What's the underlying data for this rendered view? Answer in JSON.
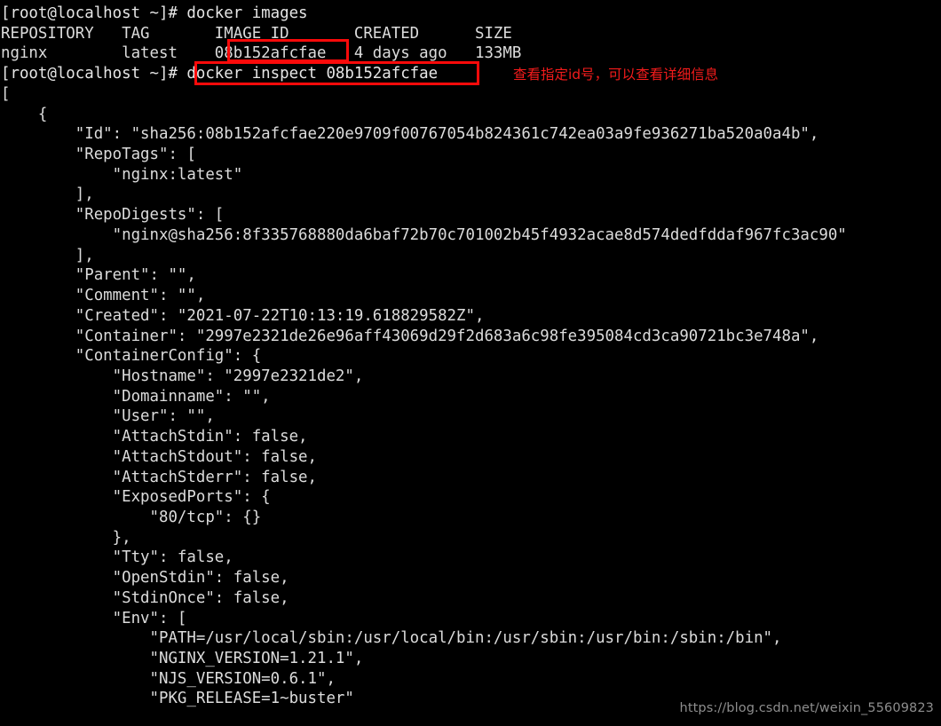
{
  "terminal": {
    "colors": {
      "background": "#000000",
      "foreground": "#dcdcdc",
      "annotation_red": "#f21b1b",
      "box_red": "#fb0a0a",
      "watermark_gray": "#8d8d8d"
    },
    "prompt": "[root@localhost ~]#",
    "commands": [
      "docker images",
      "docker inspect 08b152afcfae"
    ],
    "images_table": {
      "headers": [
        "REPOSITORY",
        "TAG",
        "IMAGE ID",
        "CREATED",
        "SIZE"
      ],
      "rows": [
        {
          "repository": "nginx",
          "tag": "latest",
          "image_id": "08b152afcfae",
          "created": "4 days ago",
          "size": "133MB"
        }
      ]
    },
    "lines": [
      "[root@localhost ~]# docker images",
      "REPOSITORY   TAG       IMAGE ID       CREATED      SIZE",
      "nginx        latest    08b152afcfae   4 days ago   133MB",
      "[root@localhost ~]# docker inspect 08b152afcfae",
      "[",
      "    {",
      "        \"Id\": \"sha256:08b152afcfae220e9709f00767054b824361c742ea03a9fe936271ba520a0a4b\",",
      "        \"RepoTags\": [",
      "            \"nginx:latest\"",
      "        ],",
      "        \"RepoDigests\": [",
      "            \"nginx@sha256:8f335768880da6baf72b70c701002b45f4932acae8d574dedfddaf967fc3ac90\"",
      "        ],",
      "        \"Parent\": \"\",",
      "        \"Comment\": \"\",",
      "        \"Created\": \"2021-07-22T10:13:19.618829582Z\",",
      "        \"Container\": \"2997e2321de26e96aff43069d29f2d683a6c98fe395084cd3ca90721bc3e748a\",",
      "        \"ContainerConfig\": {",
      "            \"Hostname\": \"2997e2321de2\",",
      "            \"Domainname\": \"\",",
      "            \"User\": \"\",",
      "            \"AttachStdin\": false,",
      "            \"AttachStdout\": false,",
      "            \"AttachStderr\": false,",
      "            \"ExposedPorts\": {",
      "                \"80/tcp\": {}",
      "            },",
      "            \"Tty\": false,",
      "            \"OpenStdin\": false,",
      "            \"StdinOnce\": false,",
      "            \"Env\": [",
      "                \"PATH=/usr/local/sbin:/usr/local/bin:/usr/sbin:/usr/bin:/sbin:/bin\",",
      "                \"NGINX_VERSION=1.21.1\",",
      "                \"NJS_VERSION=0.6.1\",",
      "                \"PKG_RELEASE=1~buster\""
    ],
    "inspect_output": {
      "Id": "sha256:08b152afcfae220e9709f00767054b824361c742ea03a9fe936271ba520a0a4b",
      "RepoTags": [
        "nginx:latest"
      ],
      "RepoDigests": [
        "nginx@sha256:8f335768880da6baf72b70c701002b45f4932acae8d574dedfddaf967fc3ac90"
      ],
      "Parent": "",
      "Comment": "",
      "Created": "2021-07-22T10:13:19.618829582Z",
      "Container": "2997e2321de26e96aff43069d29f2d683a6c98fe395084cd3ca90721bc3e748a",
      "ContainerConfig": {
        "Hostname": "2997e2321de2",
        "Domainname": "",
        "User": "",
        "AttachStdin": "false",
        "AttachStdout": "false",
        "AttachStderr": "false",
        "ExposedPorts": [
          "80/tcp"
        ],
        "Tty": "false",
        "OpenStdin": "false",
        "StdinOnce": "false",
        "Env": [
          "PATH=/usr/local/sbin:/usr/local/bin:/usr/sbin:/usr/bin:/sbin:/bin",
          "NGINX_VERSION=1.21.1",
          "NJS_VERSION=0.6.1",
          "PKG_RELEASE=1~buster"
        ]
      }
    }
  },
  "annotations": {
    "note": "查看指定id号，可以查看详细信息",
    "highlight_image_id": "08b152afcfae",
    "highlight_command": "docker inspect 08b152afcfae"
  },
  "watermark": {
    "text": "https://blog.csdn.net/weixin_55609823"
  }
}
